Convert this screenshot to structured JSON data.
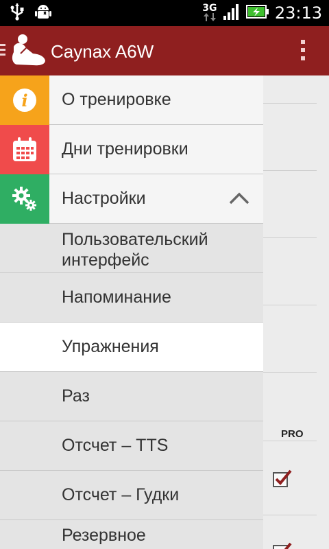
{
  "status_bar": {
    "network": "3G",
    "time": "23:13"
  },
  "action_bar": {
    "title": "Caynax A6W"
  },
  "drawer": {
    "primary_items": [
      {
        "label": "О тренировке",
        "icon": "info-icon",
        "color": "#f6a31b"
      },
      {
        "label": "Дни тренировки",
        "icon": "calendar-icon",
        "color": "#f04b4b"
      },
      {
        "label": "Настройки",
        "icon": "gears-icon",
        "color": "#2fae63",
        "expanded": true
      }
    ],
    "sub_items": [
      {
        "label_line1": "Пользовательский",
        "label_line2": "интерфейс"
      },
      {
        "label": "Напоминание"
      },
      {
        "label": "Упражнения",
        "selected": true
      },
      {
        "label": "Раз"
      },
      {
        "label": "Отсчет – TTS"
      },
      {
        "label": "Отсчет – Гудки"
      },
      {
        "label": "Резервное"
      }
    ]
  },
  "background": {
    "pro_badge": "PRO"
  },
  "colors": {
    "action_bar": "#8f1f1f",
    "status_bar": "#000000"
  }
}
